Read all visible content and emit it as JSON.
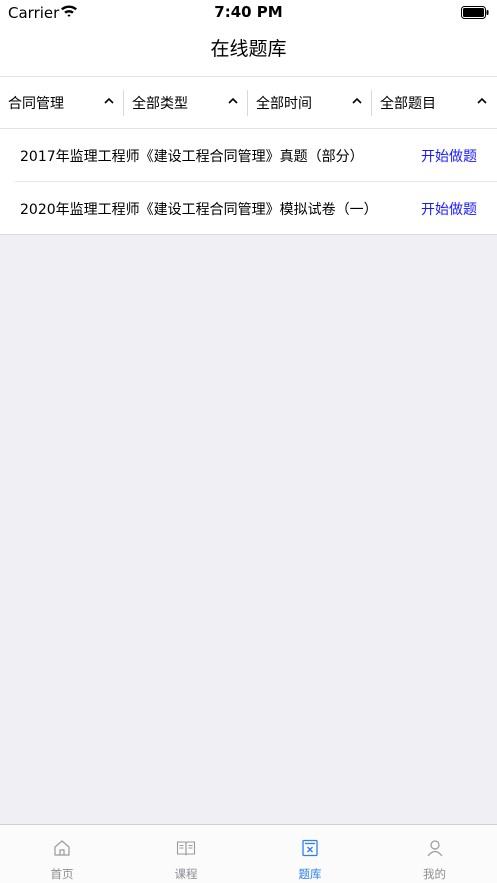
{
  "status_bar": {
    "carrier": "Carrier",
    "time": "7:40 PM"
  },
  "nav": {
    "title": "在线题库"
  },
  "filters": [
    {
      "label": "合同管理"
    },
    {
      "label": "全部类型"
    },
    {
      "label": "全部时间"
    },
    {
      "label": "全部题目"
    }
  ],
  "exams": [
    {
      "title": "2017年监理工程师《建设工程合同管理》真题（部分）",
      "action": "开始做题"
    },
    {
      "title": "2020年监理工程师《建设工程合同管理》模拟试卷（一）",
      "action": "开始做题"
    }
  ],
  "tabs": [
    {
      "label": "首页",
      "icon": "home-icon"
    },
    {
      "label": "课程",
      "icon": "book-icon"
    },
    {
      "label": "题库",
      "icon": "exam-icon",
      "active": true
    },
    {
      "label": "我的",
      "icon": "user-icon"
    }
  ],
  "colors": {
    "accent": "#2c7ff5",
    "action_link": "#1919ff",
    "background": "#efeff4"
  }
}
